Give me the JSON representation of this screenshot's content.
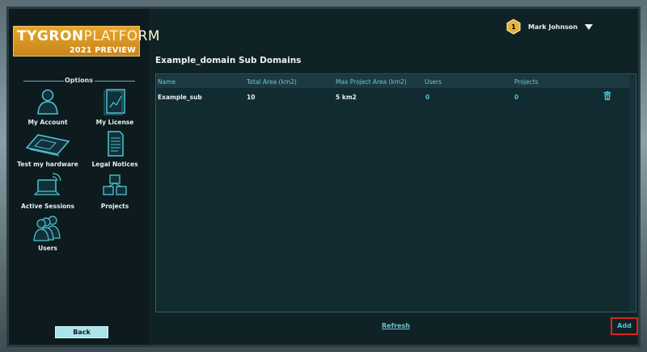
{
  "sidebar": {
    "logo_main_bold": "TYGRON",
    "logo_main_thin": "PLATFORM",
    "logo_sub": "2021 PREVIEW",
    "options_title": "Options",
    "items": [
      {
        "label": "My Account",
        "icon": "account-icon"
      },
      {
        "label": "My License",
        "icon": "license-icon"
      },
      {
        "label": "Test my hardware",
        "icon": "hardware-icon"
      },
      {
        "label": "Legal Notices",
        "icon": "legal-notices-icon"
      },
      {
        "label": "Active Sessions",
        "icon": "sessions-icon"
      },
      {
        "label": "Projects",
        "icon": "projects-icon"
      },
      {
        "label": "Users",
        "icon": "users-icon"
      }
    ],
    "back_label": "Back"
  },
  "header": {
    "user_level": "1",
    "user_name": "Mark Johnson"
  },
  "main": {
    "title": "Example_domain Sub Domains",
    "columns": [
      "Name",
      "Total Area (km2)",
      "Max Project Area (km2)",
      "Users",
      "Projects"
    ],
    "rows": [
      {
        "name": "Example_sub",
        "total_area": "10",
        "max_project_area": "5 km2",
        "users": "0",
        "projects": "0"
      }
    ],
    "refresh_label": "Refresh",
    "add_label": "Add"
  },
  "colors": {
    "accent": "#4fc4d4",
    "highlight": "#e02020",
    "logo": "#e6a52a"
  }
}
